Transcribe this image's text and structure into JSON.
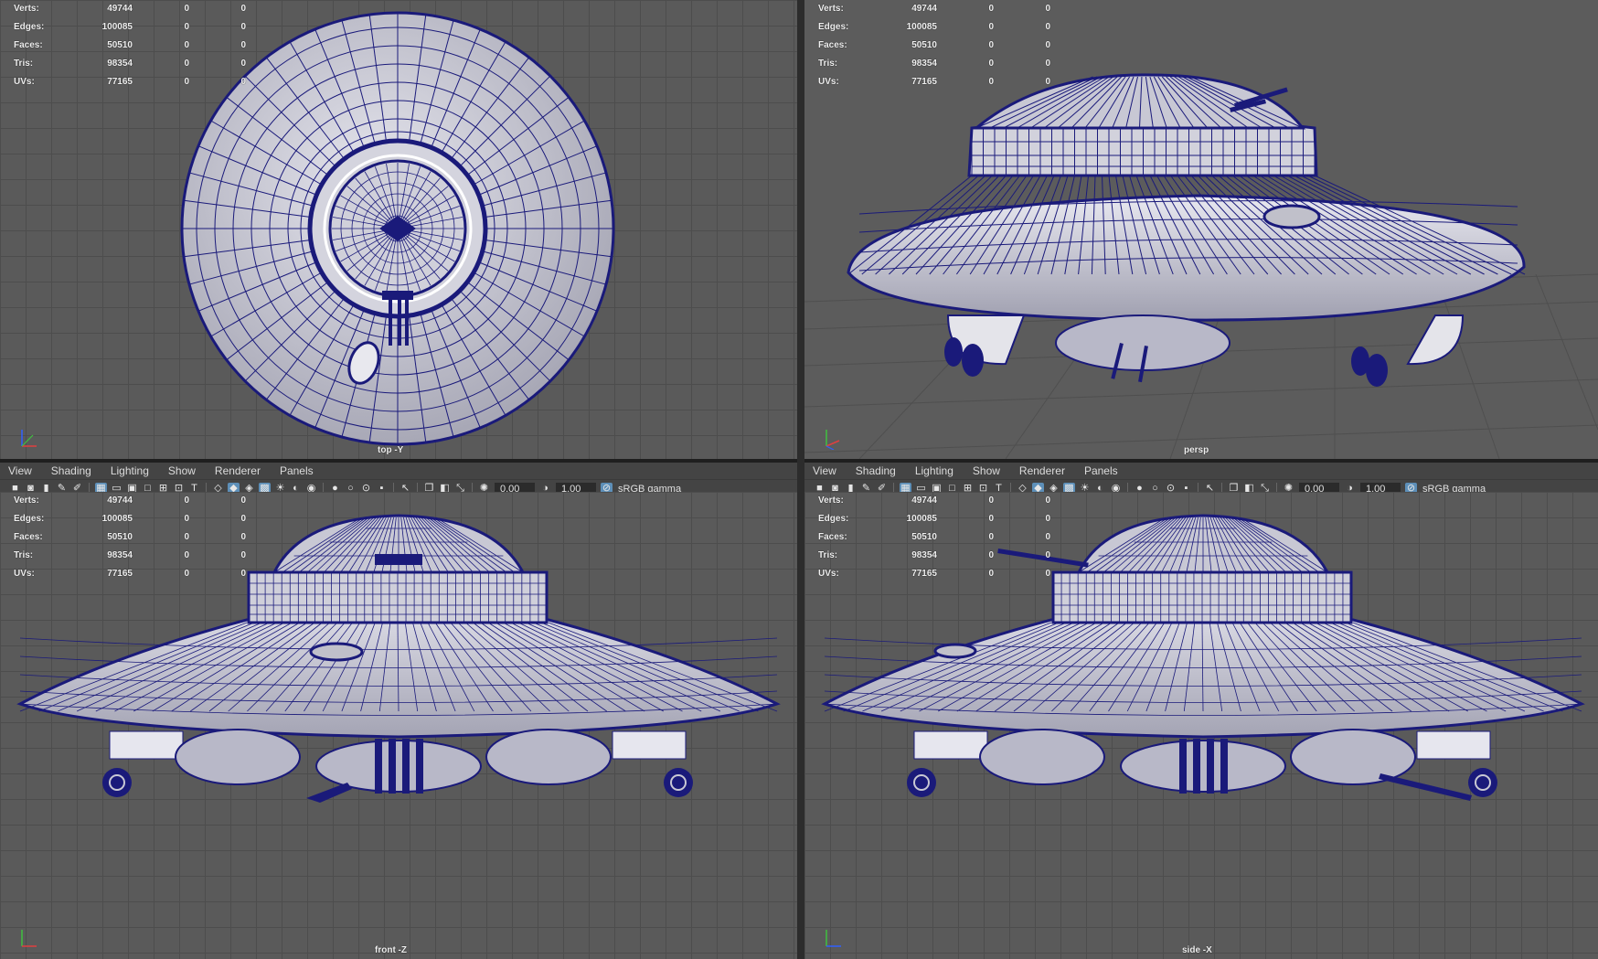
{
  "stats": {
    "rows": [
      {
        "label": "Verts:",
        "value": "49744",
        "sel": "0",
        "z": "0"
      },
      {
        "label": "Edges:",
        "value": "100085",
        "sel": "0",
        "z": "0"
      },
      {
        "label": "Faces:",
        "value": "50510",
        "sel": "0",
        "z": "0"
      },
      {
        "label": "Tris:",
        "value": "98354",
        "sel": "0",
        "z": "0"
      },
      {
        "label": "UVs:",
        "value": "77165",
        "sel": "0",
        "z": "0"
      }
    ]
  },
  "viewports": {
    "top": {
      "camera": "top -Y"
    },
    "persp": {
      "camera": "persp"
    },
    "front": {
      "camera": "front -Z"
    },
    "side": {
      "camera": "side -X"
    }
  },
  "panel_menu": [
    "View",
    "Shading",
    "Lighting",
    "Show",
    "Renderer",
    "Panels"
  ],
  "panel_toolbar": {
    "exposure": "0.00",
    "gamma": "1.00",
    "color_space": "sRGB gamma"
  },
  "colors": {
    "wire": "#1a1a7a",
    "shade": "#c9c9d4",
    "bg": "#5a5a5a",
    "grid": "#4d4d4d",
    "active_icon": "#5d8fb8"
  }
}
